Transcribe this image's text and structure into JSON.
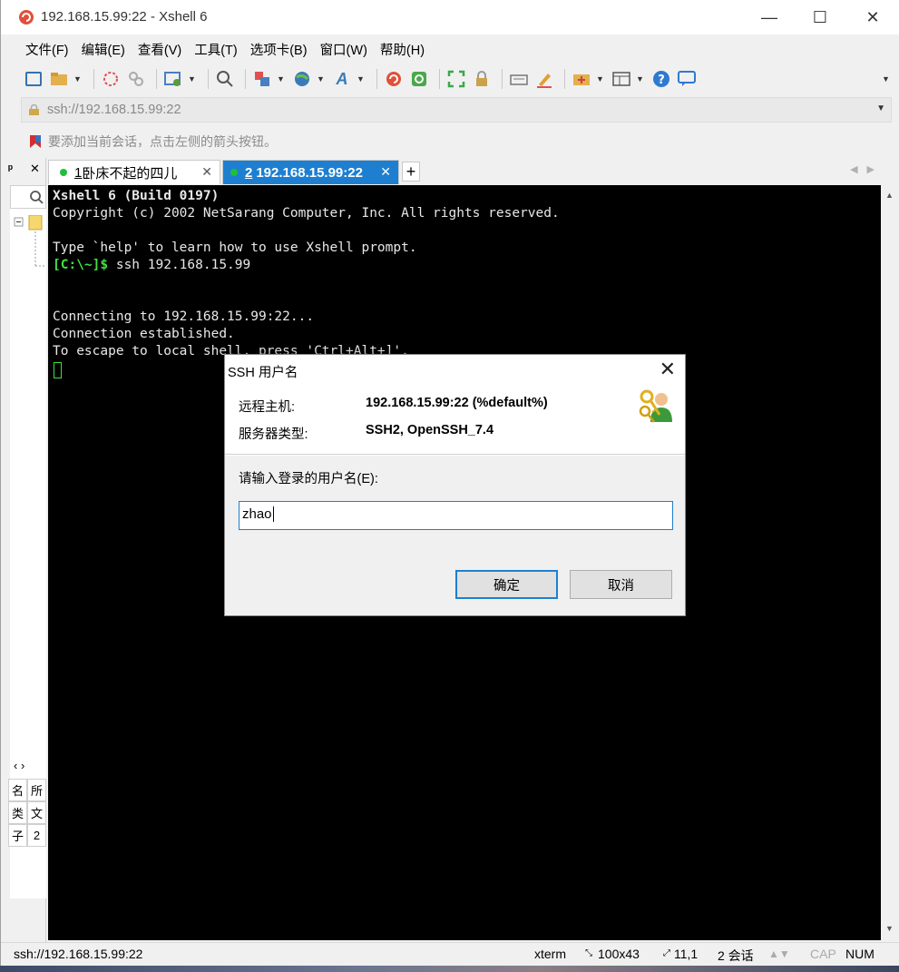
{
  "window": {
    "title": "192.168.15.99:22 - Xshell 6",
    "minimize": "—",
    "maximize": "☐",
    "close": "✕"
  },
  "menu": [
    "文件(F)",
    "编辑(E)",
    "查看(V)",
    "工具(T)",
    "选项卡(B)",
    "窗口(W)",
    "帮助(H)"
  ],
  "address": {
    "value": "ssh://192.168.15.99:22"
  },
  "hint": "要添加当前会话，点击左侧的箭头按钮。",
  "left_panel": {
    "header_pin": "ᵖ",
    "header_close": "✕",
    "nav": "‹ ›",
    "cells": [
      "名",
      "所",
      "类",
      "文",
      "子",
      "2"
    ]
  },
  "tabs": [
    {
      "number": "1",
      "label": "卧床不起的四儿"
    },
    {
      "number": "2",
      "label": "192.168.15.99:22"
    }
  ],
  "terminal": {
    "lines": [
      "Xshell 6 (Build 0197)",
      "Copyright (c) 2002 NetSarang Computer, Inc. All rights reserved.",
      "",
      "Type `help' to learn how to use Xshell prompt.",
      "[C:\\~]$ ssh 192.168.15.99",
      "",
      "",
      "Connecting to 192.168.15.99:22...",
      "Connection established.",
      "To escape to local shell, press 'Ctrl+Alt+]'."
    ],
    "prompt": "[C:\\~]$",
    "command": " ssh 192.168.15.99"
  },
  "dialog": {
    "title": "SSH 用户名",
    "remote_host_label": "远程主机:",
    "remote_host_value": "192.168.15.99:22 (%default%)",
    "server_type_label": "服务器类型:",
    "server_type_value": "SSH2, OpenSSH_7.4",
    "username_prompt": "请输入登录的用户名(E):",
    "username_value": "zhao",
    "ok": "确定",
    "cancel": "取消"
  },
  "status": {
    "address": "ssh://192.168.15.99:22",
    "term": "xterm",
    "size": "100x43",
    "position": "11,1",
    "sessions": "2 会话",
    "cap": "CAP",
    "num": "NUM"
  },
  "colors": {
    "accent": "#1e7fd0",
    "terminal_bg": "#000000",
    "terminal_prompt": "#40e040"
  }
}
